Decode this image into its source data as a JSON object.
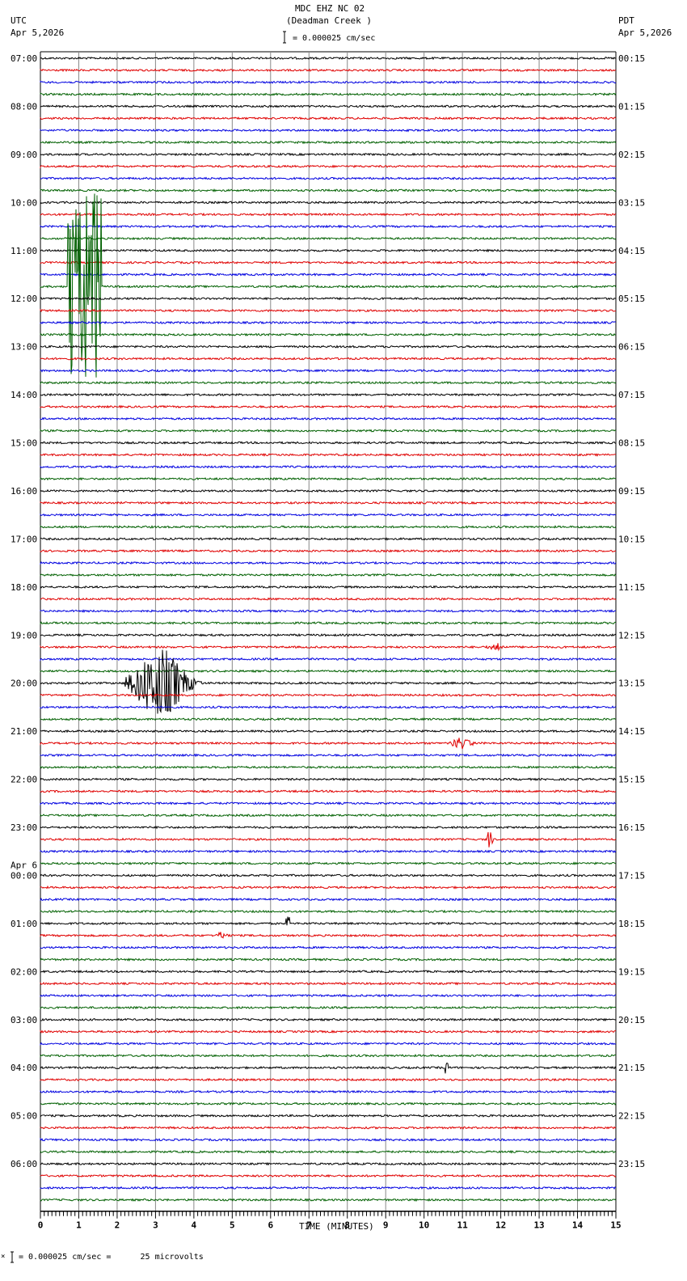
{
  "header": {
    "title": "MDC EHZ NC 02",
    "subtitle": "(Deadman Creek )",
    "left_tz": "UTC",
    "left_date": "Apr 5,2026",
    "right_tz": "PDT",
    "right_date": "Apr 5,2026",
    "scale_label": "= 0.000025 cm/sec"
  },
  "footer": {
    "scale_note": "= 0.000025 cm/sec =      25 microvolts",
    "mark": "×"
  },
  "chart_data": {
    "type": "line",
    "title": "MDC EHZ NC 02 (Deadman Creek )",
    "xlabel": "TIME (MINUTES)",
    "xlim": [
      0,
      15
    ],
    "x_ticks": [
      "0",
      "1",
      "2",
      "3",
      "4",
      "5",
      "6",
      "7",
      "8",
      "9",
      "10",
      "11",
      "12",
      "13",
      "14",
      "15"
    ],
    "trace_count": 96,
    "trace_minutes": 15,
    "trace_colors": [
      "#000000",
      "#e00000",
      "#0000e0",
      "#006000"
    ],
    "grid": true,
    "left_labels": [
      "07:00",
      "08:00",
      "09:00",
      "10:00",
      "11:00",
      "12:00",
      "13:00",
      "14:00",
      "15:00",
      "16:00",
      "17:00",
      "18:00",
      "19:00",
      "20:00",
      "21:00",
      "22:00",
      "23:00",
      "00:00",
      "01:00",
      "02:00",
      "03:00",
      "04:00",
      "05:00",
      "06:00"
    ],
    "date_change_label": "Apr 6",
    "right_labels": [
      "00:15",
      "01:15",
      "02:15",
      "03:15",
      "04:15",
      "05:15",
      "06:15",
      "07:15",
      "08:15",
      "09:15",
      "10:15",
      "11:15",
      "12:15",
      "13:15",
      "14:15",
      "15:15",
      "16:15",
      "17:15",
      "18:15",
      "19:15",
      "20:15",
      "21:15",
      "22:15",
      "23:15"
    ],
    "events": [
      {
        "trace": 19,
        "minute": 0.7,
        "duration": 0.9,
        "amplitude": 8,
        "kind": "glitch"
      },
      {
        "trace": 52,
        "minute": 2.2,
        "duration": 2.0,
        "amplitude": 3,
        "kind": "quake"
      },
      {
        "trace": 49,
        "minute": 11.6,
        "duration": 0.6,
        "amplitude": 0.3,
        "kind": "quake"
      },
      {
        "trace": 57,
        "minute": 10.6,
        "duration": 0.8,
        "amplitude": 0.5,
        "kind": "quake"
      },
      {
        "trace": 65,
        "minute": 11.65,
        "duration": 0.15,
        "amplitude": 0.7,
        "kind": "spike"
      },
      {
        "trace": 73,
        "minute": 4.5,
        "duration": 0.5,
        "amplitude": 0.25,
        "kind": "quake"
      },
      {
        "trace": 72,
        "minute": 6.4,
        "duration": 0.1,
        "amplitude": 0.6,
        "kind": "spike"
      },
      {
        "trace": 84,
        "minute": 10.55,
        "duration": 0.1,
        "amplitude": 0.6,
        "kind": "spike"
      }
    ]
  }
}
